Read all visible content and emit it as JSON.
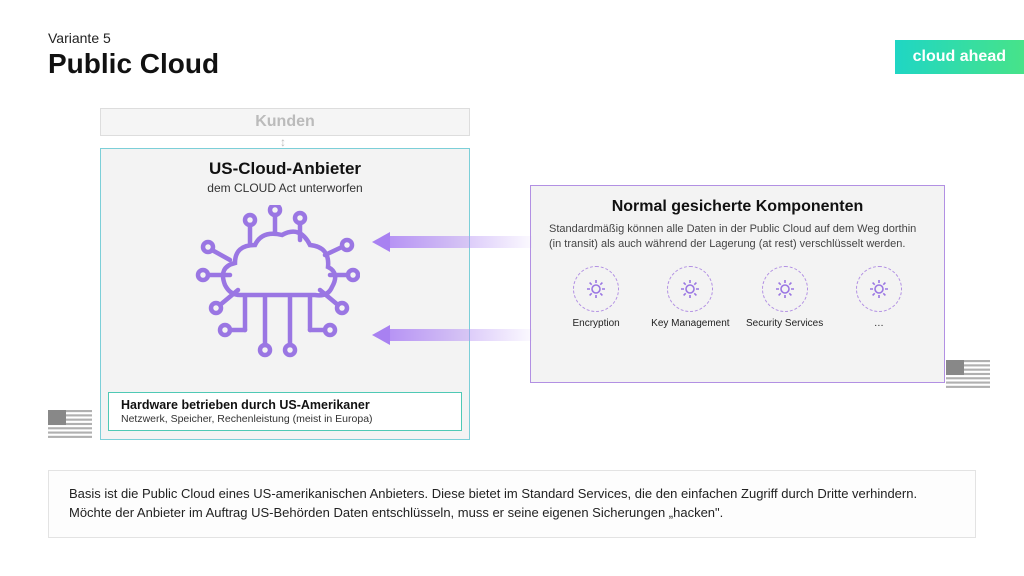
{
  "header": {
    "subtitle": "Variante 5",
    "title": "Public Cloud"
  },
  "brand": "cloud ahead",
  "kunden": "Kunden",
  "cloud_box": {
    "title": "US-Cloud-Anbieter",
    "subtitle": "dem CLOUD Act unterworfen"
  },
  "hardware_box": {
    "title": "Hardware betrieben durch US-Amerikaner",
    "subtitle": "Netzwerk, Speicher, Rechenleistung (meist in Europa)"
  },
  "security_box": {
    "title": "Normal gesicherte Komponenten",
    "description": "Standardmäßig können alle Daten in der Public Cloud auf dem Weg dorthin (in transit) als auch während der Lagerung (at rest) verschlüsselt werden.",
    "items": [
      {
        "label": "Encryption"
      },
      {
        "label": "Key Management"
      },
      {
        "label": "Security Services"
      },
      {
        "label": "…"
      }
    ]
  },
  "footer": "Basis ist die Public Cloud eines US-amerikanischen Anbieters. Diese bietet im Standard Services, die den einfachen Zugriff durch Dritte verhindern. Möchte der Anbieter im Auftrag US-Behörden Daten entschlüsseln, muss er seine eigenen Sicherungen „hacken\"."
}
